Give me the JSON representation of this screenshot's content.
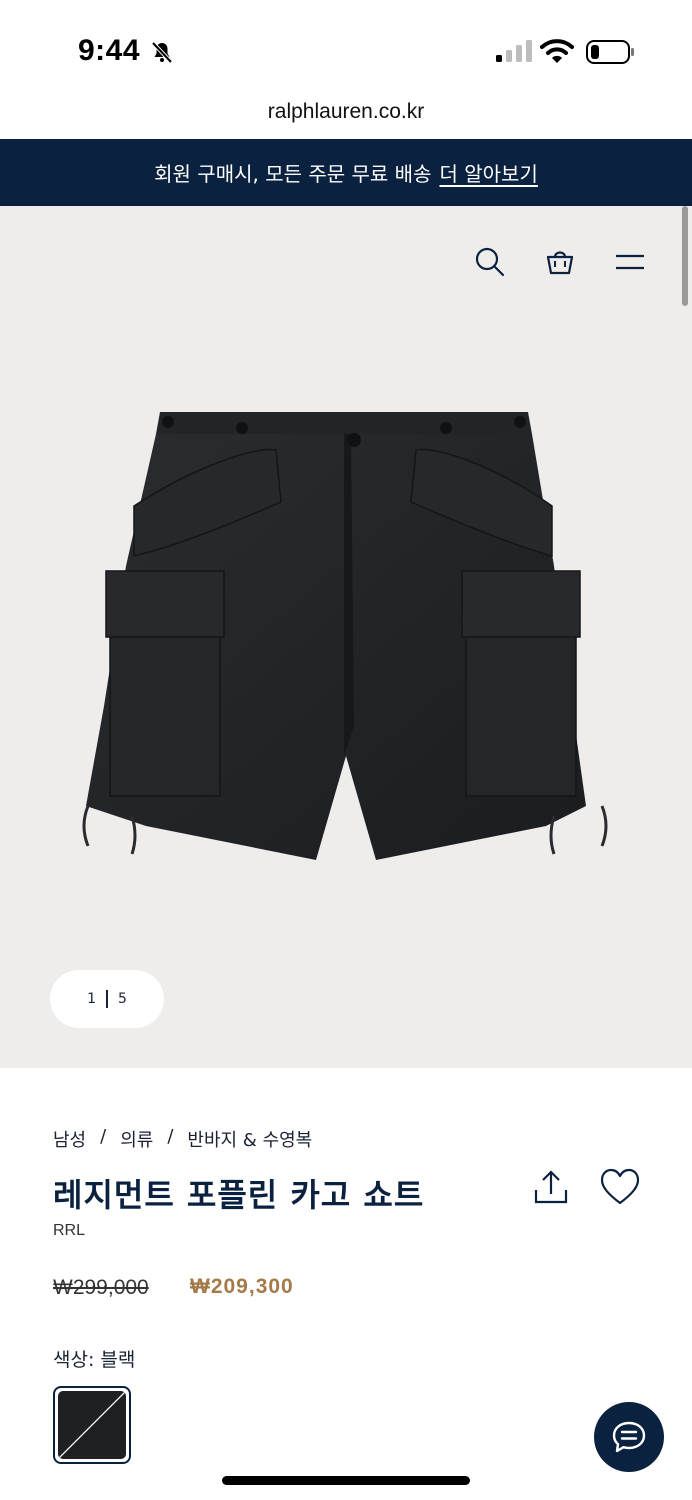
{
  "status_bar": {
    "time": "9:44"
  },
  "browser": {
    "url": "ralphlauren.co.kr"
  },
  "promo": {
    "text": "회원 구매시, 모든 주문 무료 배송",
    "link": "더 알아보기"
  },
  "header": {
    "icons": [
      "search-icon",
      "bag-icon",
      "menu-icon"
    ]
  },
  "gallery": {
    "current": "1",
    "total": "5"
  },
  "breadcrumb": {
    "items": [
      "남성",
      "의류",
      "반바지 & 수영복"
    ],
    "separator": "/"
  },
  "product": {
    "title": "레지먼트 포플린 카고 쇼트",
    "brand": "RRL",
    "price_original": "₩299,000",
    "price_sale": "₩209,300",
    "color_label": "색상: 블랙",
    "swatch_color": "#1e2023"
  },
  "colors": {
    "navy": "#0a2240",
    "sale": "#a47a48",
    "hero_bg": "#eeedec"
  }
}
